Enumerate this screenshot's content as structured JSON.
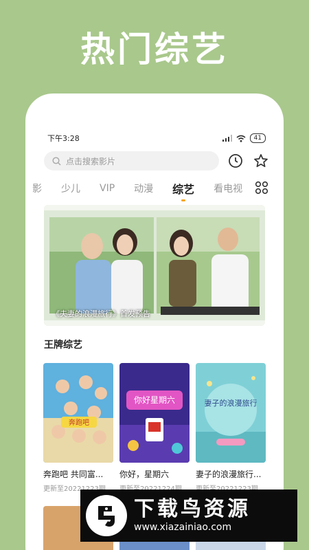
{
  "promo": {
    "title": "热门综艺"
  },
  "status": {
    "time": "下午3:28",
    "battery": "41"
  },
  "search": {
    "placeholder": "点击搜索影片"
  },
  "tabs": [
    {
      "label": "影"
    },
    {
      "label": "少儿"
    },
    {
      "label": "VIP"
    },
    {
      "label": "动漫"
    },
    {
      "label": "综艺",
      "active": true
    },
    {
      "label": "看电视"
    }
  ],
  "banner": {
    "caption": "《夫妻的浪漫旅行》首发预告"
  },
  "section": {
    "title": "王牌综艺"
  },
  "cards": [
    {
      "title": "奔跑吧 共同富...",
      "subtitle": "更新至20221223期"
    },
    {
      "title": "你好，星期六",
      "subtitle": "更新至20221224期"
    },
    {
      "title": "妻子的浪漫旅行...",
      "subtitle": "更新至20221223期"
    }
  ],
  "posters": {
    "p1_text": "奔跑吧",
    "p2_text": "你好星期六",
    "p3_text": "妻子的浪漫旅行"
  },
  "watermark": {
    "name": "下载鸟资源",
    "url": "www.xiazainiao.com"
  },
  "colors": {
    "background": "#a9c88c",
    "accent": "#f5a623"
  }
}
